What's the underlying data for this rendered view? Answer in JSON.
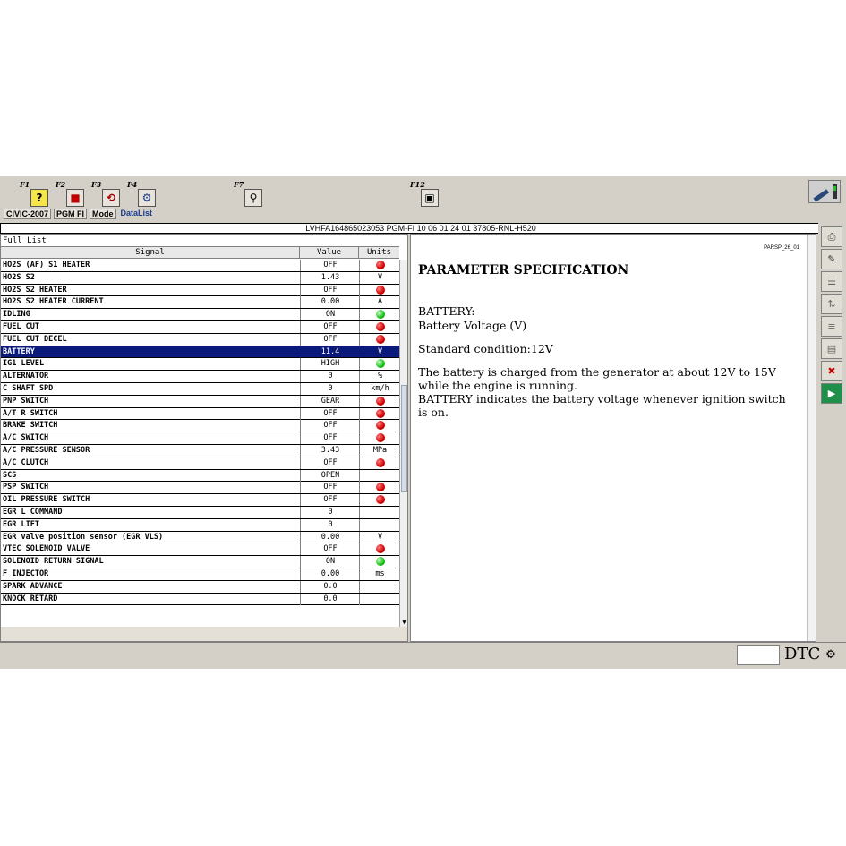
{
  "toolbar": {
    "f1": "F1",
    "f2": "F2",
    "f3": "F3",
    "f4": "F4",
    "f7": "F7",
    "f12": "F12"
  },
  "breadcrumb": [
    "CIVIC-2007",
    "PGM FI",
    "Mode",
    "DataList"
  ],
  "vin_line": "LVHFA164865023053  PGM-FI  10 06 01 24 01  37805-RNL-H520",
  "left_panel": {
    "title": "Full List",
    "columns": {
      "signal": "Signal",
      "value": "Value",
      "units": "Units"
    },
    "rows": [
      {
        "signal": "HO2S (AF) S1 HEATER",
        "value": "OFF",
        "unit": "",
        "indicator": "red"
      },
      {
        "signal": "HO2S S2",
        "value": "1.43",
        "unit": "V",
        "indicator": ""
      },
      {
        "signal": "HO2S S2 HEATER",
        "value": "OFF",
        "unit": "",
        "indicator": "red"
      },
      {
        "signal": "HO2S S2 HEATER CURRENT",
        "value": "0.00",
        "unit": "A",
        "indicator": ""
      },
      {
        "signal": "IDLING",
        "value": "ON",
        "unit": "",
        "indicator": "green"
      },
      {
        "signal": "FUEL CUT",
        "value": "OFF",
        "unit": "",
        "indicator": "red"
      },
      {
        "signal": "FUEL CUT DECEL",
        "value": "OFF",
        "unit": "",
        "indicator": "red"
      },
      {
        "signal": "BATTERY",
        "value": "11.4",
        "unit": "V",
        "indicator": "",
        "selected": true
      },
      {
        "signal": "IG1 LEVEL",
        "value": "HIGH",
        "unit": "",
        "indicator": "green"
      },
      {
        "signal": "ALTERNATOR",
        "value": "0",
        "unit": "%",
        "indicator": ""
      },
      {
        "signal": "C SHAFT SPD",
        "value": "0",
        "unit": "km/h",
        "indicator": ""
      },
      {
        "signal": "PNP SWITCH",
        "value": "GEAR",
        "unit": "",
        "indicator": "red"
      },
      {
        "signal": "A/T R SWITCH",
        "value": "OFF",
        "unit": "",
        "indicator": "red"
      },
      {
        "signal": "BRAKE SWITCH",
        "value": "OFF",
        "unit": "",
        "indicator": "red"
      },
      {
        "signal": "A/C SWITCH",
        "value": "OFF",
        "unit": "",
        "indicator": "red"
      },
      {
        "signal": "A/C PRESSURE SENSOR",
        "value": "3.43",
        "unit": "MPa",
        "indicator": ""
      },
      {
        "signal": "A/C CLUTCH",
        "value": "OFF",
        "unit": "",
        "indicator": "red"
      },
      {
        "signal": "SCS",
        "value": "OPEN",
        "unit": "",
        "indicator": ""
      },
      {
        "signal": "PSP SWITCH",
        "value": "OFF",
        "unit": "",
        "indicator": "red"
      },
      {
        "signal": "OIL PRESSURE SWITCH",
        "value": "OFF",
        "unit": "",
        "indicator": "red"
      },
      {
        "signal": "EGR L COMMAND",
        "value": "0",
        "unit": "",
        "indicator": ""
      },
      {
        "signal": "EGR LIFT",
        "value": "0",
        "unit": "",
        "indicator": ""
      },
      {
        "signal": "EGR valve position sensor (EGR VLS)",
        "value": "0.00",
        "unit": "V",
        "indicator": ""
      },
      {
        "signal": "VTEC SOLENOID VALVE",
        "value": "OFF",
        "unit": "",
        "indicator": "red"
      },
      {
        "signal": "SOLENOID RETURN SIGNAL",
        "value": "ON",
        "unit": "",
        "indicator": "green"
      },
      {
        "signal": "F INJECTOR",
        "value": "0.00",
        "unit": "ms",
        "indicator": ""
      },
      {
        "signal": "SPARK ADVANCE",
        "value": "0.0",
        "unit": "",
        "indicator": ""
      },
      {
        "signal": "KNOCK RETARD",
        "value": "0.0",
        "unit": "",
        "indicator": ""
      }
    ]
  },
  "right_panel": {
    "page_id": "PARSP_26_01",
    "title": "PARAMETER SPECIFICATION",
    "battery_name": "BATTERY:",
    "battery_desc": "Battery Voltage (V)",
    "standard_condition": "Standard condition:12V",
    "paragraph1": "The battery is charged from the generator at about 12V to 15V while the engine is running.",
    "paragraph2": "BATTERY indicates the battery voltage whenever ignition switch is on."
  },
  "status_bar": {
    "dtc_label": "DTC"
  },
  "icons": {
    "f1": "help-icon",
    "f2": "car-icon",
    "f3": "reset-icon",
    "f4": "tools-icon",
    "f7": "search-icon",
    "f12": "screen-print-icon",
    "top_right": "scanner-icon",
    "side": [
      "printer-icon",
      "graph-icon",
      "list-icon",
      "sort-icon",
      "tune-icon",
      "chart-icon",
      "temperature-icon",
      "exit-icon"
    ]
  },
  "colors": {
    "selected_row": "#0a1a7a",
    "indicator_red": "#d40000",
    "indicator_green": "#18c018"
  }
}
